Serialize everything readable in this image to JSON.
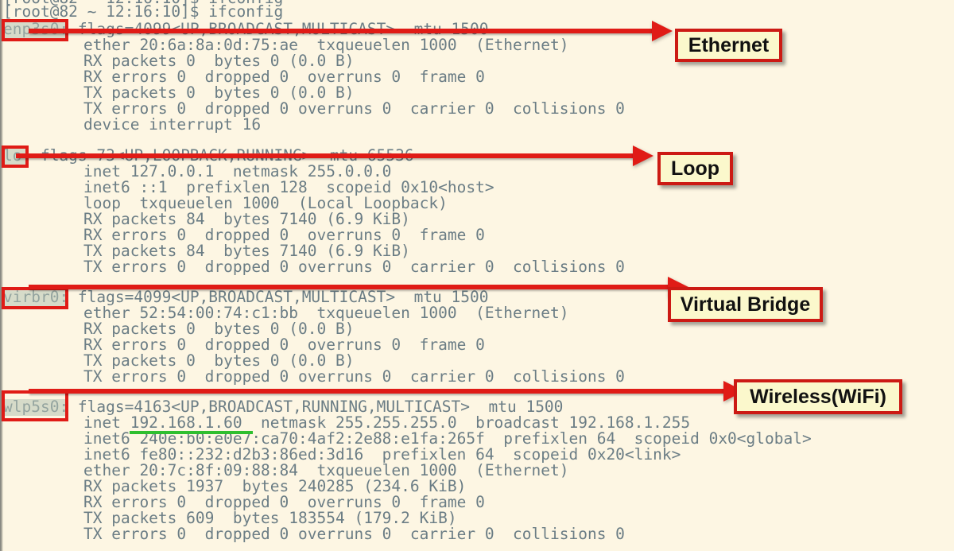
{
  "terminal": {
    "prompt_line_partial": "[root@82 ~ 12:16:10]$ ifconfig",
    "sections": [
      {
        "name": "enp3s0",
        "header_rest": ": flags=4099<UP,BROADCAST,MULTICAST>  mtu 1500",
        "lines": [
          "ether 20:6a:8a:0d:75:ae  txqueuelen 1000  (Ethernet)",
          "RX packets 0  bytes 0 (0.0 B)",
          "RX errors 0  dropped 0  overruns 0  frame 0",
          "TX packets 0  bytes 0 (0.0 B)",
          "TX errors 0  dropped 0 overruns 0  carrier 0  collisions 0",
          "device interrupt 16"
        ]
      },
      {
        "name": "lo",
        "header_rest": ": flags=73<UP,LOOPBACK,RUNNING>  mtu 65536",
        "lines": [
          "inet 127.0.0.1  netmask 255.0.0.0",
          "inet6 ::1  prefixlen 128  scopeid 0x10<host>",
          "loop  txqueuelen 1000  (Local Loopback)",
          "RX packets 84  bytes 7140 (6.9 KiB)",
          "RX errors 0  dropped 0  overruns 0  frame 0",
          "TX packets 84  bytes 7140 (6.9 KiB)",
          "TX errors 0  dropped 0 overruns 0  carrier 0  collisions 0"
        ]
      },
      {
        "name": "virbr0",
        "header_rest": ": flags=4099<UP,BROADCAST,MULTICAST>  mtu 1500",
        "lines": [
          "ether 52:54:00:74:c1:bb  txqueuelen 1000  (Ethernet)",
          "RX packets 0  bytes 0 (0.0 B)",
          "RX errors 0  dropped 0  overruns 0  frame 0",
          "TX packets 0  bytes 0 (0.0 B)",
          "TX errors 0  dropped 0 overruns 0  carrier 0  collisions 0"
        ]
      },
      {
        "name": "wlp5s0",
        "header_rest": ": flags=4163<UP,BROADCAST,RUNNING,MULTICAST>  mtu 1500",
        "lines": [
          "inet 192.168.1.60  netmask 255.255.255.0  broadcast 192.168.1.255",
          "inet6 240e:b0:e0e7:ca70:4af2:2e88:e1fa:265f  prefixlen 64  scopeid 0x0<global>",
          "inet6 fe80::232:d2b3:86ed:3d16  prefixlen 64  scopeid 0x20<link>",
          "ether 20:7c:8f:09:88:84  txqueuelen 1000  (Ethernet)",
          "RX packets 1937  bytes 240285 (234.6 KiB)",
          "RX errors 0  dropped 0  overruns 0  frame 0",
          "TX packets 609  bytes 183554 (179.2 KiB)",
          "TX errors 0  dropped 0 overruns 0  carrier 0  collisions 0"
        ]
      }
    ]
  },
  "annotations": {
    "callouts": [
      {
        "label": "Ethernet",
        "target": "enp3s0"
      },
      {
        "label": "Loop",
        "target": "lo"
      },
      {
        "label": "Virtual Bridge",
        "target": "virbr0"
      },
      {
        "label": "Wireless(WiFi)",
        "target": "wlp5s0"
      }
    ],
    "highlighted_value": "192.168.1.60"
  },
  "colors": {
    "background": "#fdf6e3",
    "text": "#6b7d85",
    "annotation_red": "#e01b16",
    "callout_fill": "#fbf8cc",
    "underline_green": "#2fbf2f"
  }
}
